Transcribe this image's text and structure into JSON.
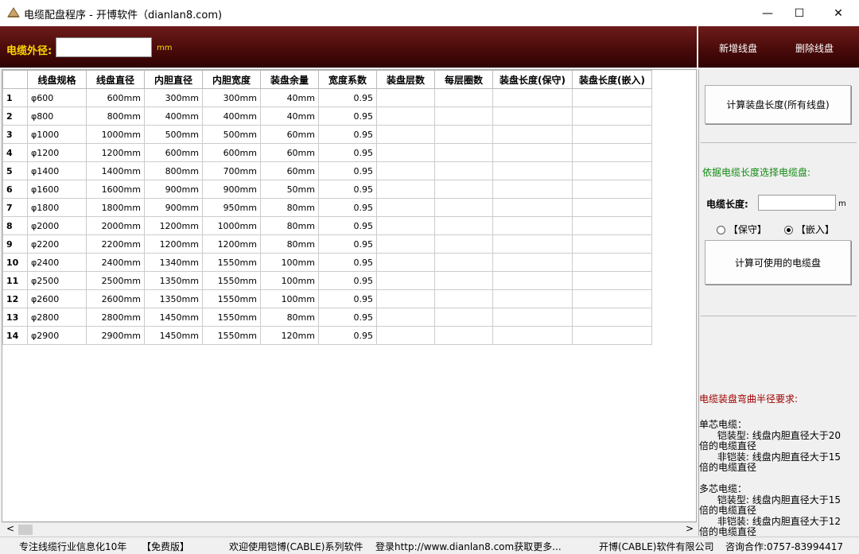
{
  "window": {
    "title": "电缆配盘程序 - 开博软件（dianlan8.com)",
    "minimize": "—",
    "maximize": "☐",
    "close": "✕"
  },
  "toolbar": {
    "od_label": "电缆外径:",
    "od_value": "",
    "od_unit": "mm",
    "add_reel": "新增线盘",
    "delete_reel": "删除线盘"
  },
  "table": {
    "headers": [
      "",
      "线盘规格",
      "线盘直径",
      "内胆直径",
      "内胆宽度",
      "装盘余量",
      "宽度系数",
      "装盘层数",
      "每层圈数",
      "装盘长度(保守)",
      "装盘长度(嵌入)"
    ],
    "rows": [
      [
        "1",
        "φ600",
        "600mm",
        "300mm",
        "300mm",
        "40mm",
        "0.95",
        "",
        "",
        "",
        ""
      ],
      [
        "2",
        "φ800",
        "800mm",
        "400mm",
        "400mm",
        "40mm",
        "0.95",
        "",
        "",
        "",
        ""
      ],
      [
        "3",
        "φ1000",
        "1000mm",
        "500mm",
        "500mm",
        "60mm",
        "0.95",
        "",
        "",
        "",
        ""
      ],
      [
        "4",
        "φ1200",
        "1200mm",
        "600mm",
        "600mm",
        "60mm",
        "0.95",
        "",
        "",
        "",
        ""
      ],
      [
        "5",
        "φ1400",
        "1400mm",
        "800mm",
        "700mm",
        "60mm",
        "0.95",
        "",
        "",
        "",
        ""
      ],
      [
        "6",
        "φ1600",
        "1600mm",
        "900mm",
        "900mm",
        "50mm",
        "0.95",
        "",
        "",
        "",
        ""
      ],
      [
        "7",
        "φ1800",
        "1800mm",
        "900mm",
        "950mm",
        "80mm",
        "0.95",
        "",
        "",
        "",
        ""
      ],
      [
        "8",
        "φ2000",
        "2000mm",
        "1200mm",
        "1000mm",
        "80mm",
        "0.95",
        "",
        "",
        "",
        ""
      ],
      [
        "9",
        "φ2200",
        "2200mm",
        "1200mm",
        "1200mm",
        "80mm",
        "0.95",
        "",
        "",
        "",
        ""
      ],
      [
        "10",
        "φ2400",
        "2400mm",
        "1340mm",
        "1550mm",
        "100mm",
        "0.95",
        "",
        "",
        "",
        ""
      ],
      [
        "11",
        "φ2500",
        "2500mm",
        "1350mm",
        "1550mm",
        "100mm",
        "0.95",
        "",
        "",
        "",
        ""
      ],
      [
        "12",
        "φ2600",
        "2600mm",
        "1350mm",
        "1550mm",
        "100mm",
        "0.95",
        "",
        "",
        "",
        ""
      ],
      [
        "13",
        "φ2800",
        "2800mm",
        "1450mm",
        "1550mm",
        "80mm",
        "0.95",
        "",
        "",
        "",
        ""
      ],
      [
        "14",
        "φ2900",
        "2900mm",
        "1450mm",
        "1550mm",
        "120mm",
        "0.95",
        "",
        "",
        "",
        ""
      ]
    ]
  },
  "scroll": {
    "left": "<",
    "right": ">"
  },
  "side": {
    "calc_all": "计算装盘长度(所有线盘)",
    "select_heading": "依据电缆长度选择电缆盘:",
    "length_label": "电缆长度:",
    "length_value": "",
    "length_unit": "m",
    "radio_conservative": "【保守】",
    "radio_embedded": "【嵌入】",
    "selected_mode": "embedded",
    "calc_usable": "计算可使用的电缆盘",
    "bend_heading": "电缆装盘弯曲半径要求:",
    "bend_lines": [
      "单芯电缆：",
      "      铠装型: 线盘内胆直径大于20",
      "倍的电缆直径",
      "      非铠装: 线盘内胆直径大于15",
      "倍的电缆直径",
      "",
      "多芯电缆：",
      "      铠装型: 线盘内胆直径大于15",
      "倍的电缆直径",
      "      非铠装: 线盘内胆直径大于12",
      "倍的电缆直径"
    ]
  },
  "status": {
    "s1": "专注线缆行业信息化10年",
    "s2": "【免费版】",
    "s3": "欢迎使用铠博(CABLE)系列软件",
    "s4": "登录http://www.dianlan8.com获取更多...",
    "s5": "开博(CABLE)软件有限公司",
    "s6": "咨询合作:0757-83994417"
  },
  "colors": {
    "toolbar_bg": "#4a0b0a",
    "label_yellow": "#ffd800",
    "heading_green": "#138a13",
    "heading_red": "#a00000"
  }
}
